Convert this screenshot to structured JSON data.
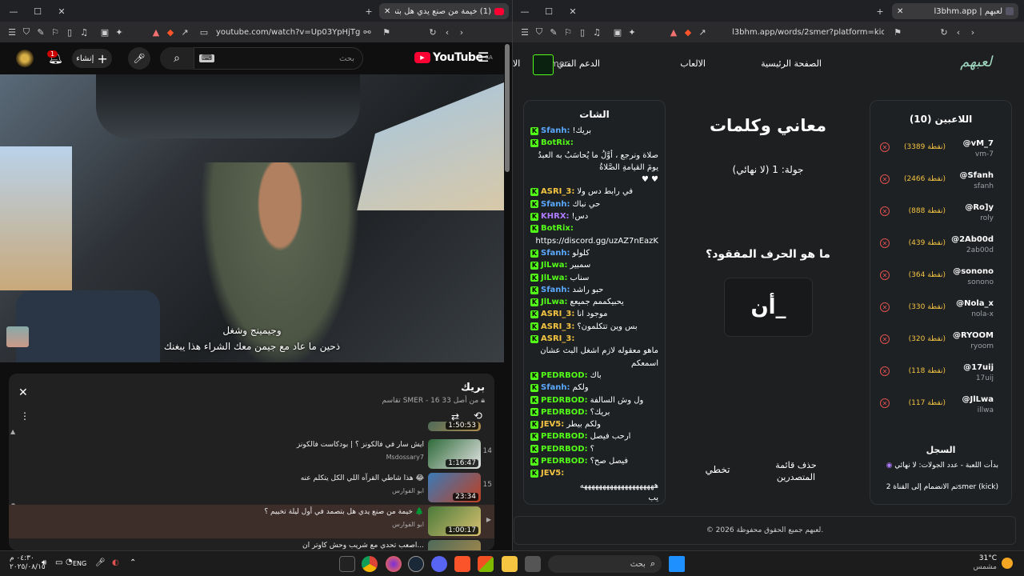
{
  "left": {
    "tab_title": "(1) خيمة من صنع يدي هل بتصـ",
    "url": "youtube.com/watch?v=Up03YpHjTg8&list...",
    "yt": {
      "logo": "YouTube",
      "region": "SA",
      "search_placeholder": "بحث",
      "create_label": "إنشاء",
      "notif_count": "1"
    },
    "subtitle1": "وجيمينج وشغل",
    "subtitle2": "ذحين ما عاد مع جيمن معك الشراء هذا يبغنك",
    "playlist": {
      "title": "بريك",
      "meta": "تقاسم SMER - 16 من أصل 33",
      "items": [
        {
          "num": "14",
          "title": "ايش سار في فالكونز ؟ | بودكاست فالكونز",
          "channel": "Msdossary7",
          "dur": "1:16:47"
        },
        {
          "num": "15",
          "title": "هذا شاطي القرآه اللي الكل يتكلم عنه 😂",
          "channel": "ابو الفوارس",
          "dur": "23:34"
        },
        {
          "num": "",
          "title": "خيمة من صنع يدي هل بتصمد في أول ليلة تخييم ؟ 🌲",
          "channel": "ابو الفوارس",
          "dur": "1:00:17"
        },
        {
          "num": "",
          "title": "اصعب تحدي مع شريب وحش كاوتر ان...",
          "channel": "",
          "dur": ""
        }
      ],
      "top_dur": "1:50:53"
    }
  },
  "right": {
    "tab_title": "لعبهم | l3bhm.app",
    "url": "l3bhm.app/words/2smer?platform=kick",
    "nav": {
      "logo": "لعبهم",
      "home": "الصفحة الرئيسية",
      "games": "الالعاب",
      "support": "الدعم الفني",
      "user": "2smer",
      "cut": "الا"
    },
    "players_title": "اللاعبين (10)",
    "players": [
      {
        "name": "@vM_7",
        "sub": "vm-7",
        "score": "(3389 نقطة)"
      },
      {
        "name": "@Sfanh",
        "sub": "sfanh",
        "score": "(2466 نقطة)"
      },
      {
        "name": "@Ro]y",
        "sub": "roly",
        "score": "(888 نقطة)"
      },
      {
        "name": "@2Ab00d",
        "sub": "2ab00d",
        "score": "(439 نقطة)"
      },
      {
        "name": "@sonono",
        "sub": "sonono",
        "score": "(364 نقطة)"
      },
      {
        "name": "@Nola_x",
        "sub": "nola-x",
        "score": "(330 نقطة)"
      },
      {
        "name": "@RYOOM",
        "sub": "ryoom",
        "score": "(320 نقطة)"
      },
      {
        "name": "@17uij",
        "sub": "17uij",
        "score": "(118 نقطة)"
      },
      {
        "name": "@JlLwa",
        "sub": "illwa",
        "score": "(117 نقطة)"
      }
    ],
    "log_title": "السجل",
    "log1": "بدأت اللعبة - عدد الجولات: لا نهائي",
    "log2": "تم الانضمام إلى القناة 2smer (kick)",
    "game_title": "معاني وكلمات",
    "round": "جولة: 1 (لا نهائي)",
    "question": "ما هو الحرف المفقود؟",
    "word": "أن_",
    "btn_delete": "حذف قائمة المتصدرين",
    "btn_skip": "تخطي",
    "chat_title": "الشات",
    "chat": [
      {
        "user": "Sfanh:",
        "msg": "بريك!",
        "color": "#5aa9ff"
      },
      {
        "user": "BotRix:",
        "msg": "",
        "color": "#53fc18"
      },
      {
        "user": "",
        "msg": "صلاة ونرجع ، أوَّلُ ما يُحاسَبُ به العبدُ",
        "color": "#fff"
      },
      {
        "user": "",
        "msg": "يومَ القيامةِ الصَّلاةُ",
        "color": "#fff"
      },
      {
        "user": "",
        "msg": "♥  ♥",
        "color": "#fff"
      },
      {
        "user": "ASRI_3:",
        "msg": "في رابط دس ولا",
        "color": "#f5c542"
      },
      {
        "user": "Sfanh:",
        "msg": "حي نباك",
        "color": "#5aa9ff"
      },
      {
        "user": "KHRX:",
        "msg": "دس!",
        "color": "#b07cff"
      },
      {
        "user": "BotRix:",
        "msg": "",
        "color": "#53fc18"
      },
      {
        "user": "",
        "msg": "https://discord.gg/uzAZ7nEazK",
        "color": "#fff"
      },
      {
        "user": "Sfanh:",
        "msg": "كلولو",
        "color": "#5aa9ff"
      },
      {
        "user": "JlLwa:",
        "msg": "سمبير",
        "color": "#53fc18"
      },
      {
        "user": "JlLwa:",
        "msg": "سناب",
        "color": "#53fc18"
      },
      {
        "user": "Sfanh:",
        "msg": "حبو راشد",
        "color": "#5aa9ff"
      },
      {
        "user": "JlLwa:",
        "msg": "يحبيكممم جميعع",
        "color": "#53fc18"
      },
      {
        "user": "ASRI_3:",
        "msg": "موجود انا",
        "color": "#f5c542"
      },
      {
        "user": "ASRI_3:",
        "msg": "بس وين تتكلمون؟",
        "color": "#f5c542"
      },
      {
        "user": "ASRI_3:",
        "msg": "",
        "color": "#f5c542"
      },
      {
        "user": "",
        "msg": "ماهو معقوله لازم اشغل البث عشان",
        "color": "#fff"
      },
      {
        "user": "",
        "msg": "اسمعكم",
        "color": "#fff"
      },
      {
        "user": "PEDRBOD:",
        "msg": "باك",
        "color": "#53fc18"
      },
      {
        "user": "Sfanh:",
        "msg": "ولكم",
        "color": "#5aa9ff"
      },
      {
        "user": "PEDRBOD:",
        "msg": "ول وش السالفة",
        "color": "#53fc18"
      },
      {
        "user": "PEDRBOD:",
        "msg": "بريك؟",
        "color": "#53fc18"
      },
      {
        "user": "JEV5:",
        "msg": "ولكم بيطر",
        "color": "#f5c542"
      },
      {
        "user": "PEDRBOD:",
        "msg": "ارحب فيصل",
        "color": "#53fc18"
      },
      {
        "user": "PEDRBOD:",
        "msg": "؟",
        "color": "#53fc18"
      },
      {
        "user": "PEDRBOD:",
        "msg": "فيصل صح؟",
        "color": "#53fc18"
      },
      {
        "user": "JEV5:",
        "msg": "",
        "color": "#f5c542"
      },
      {
        "user": "",
        "msg": "ههههههههههههههههههههه",
        "color": "#fff"
      },
      {
        "user": "",
        "msg": "يب",
        "color": "#fff"
      },
      {
        "user": "JEV5:",
        "msg": "اظن يصلون العصر",
        "color": "#f5c542"
      },
      {
        "user": "JEV5:",
        "msg": "اضن**",
        "color": "#f5c542"
      }
    ],
    "footer": "© 2026 لعبهم جميع الحقوق محفوظة."
  },
  "taskbar": {
    "time": "٠٤:٣٠ م",
    "date": "٢٠٢٥/٠٨/١٥",
    "lang": "ENG",
    "search": "بحث",
    "temp": "31°C",
    "weather": "مشمس"
  }
}
